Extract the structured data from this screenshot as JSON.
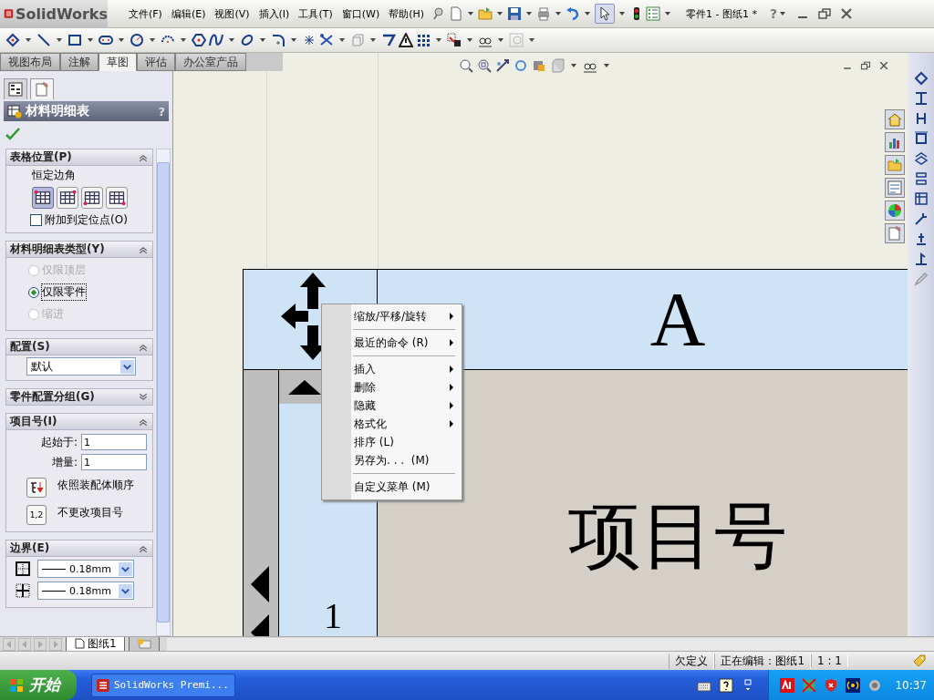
{
  "app": {
    "logo": "SolidWorks",
    "document_title": "零件1 - 图纸1 *",
    "help": "?"
  },
  "menu": [
    "文件(F)",
    "编辑(E)",
    "视图(V)",
    "插入(I)",
    "工具(T)",
    "窗口(W)",
    "帮助(H)"
  ],
  "command_tabs": [
    {
      "label": "视图布局",
      "selected": false
    },
    {
      "label": "注解",
      "selected": false
    },
    {
      "label": "草图",
      "selected": true
    },
    {
      "label": "评估",
      "selected": false
    },
    {
      "label": "办公室产品",
      "selected": false
    }
  ],
  "panel": {
    "tabs": [
      {
        "kind": "tree",
        "selected": false
      },
      {
        "kind": "property",
        "selected": true
      }
    ],
    "title": "材料明细表",
    "help": "?",
    "table_position": {
      "title": "表格位置(P)",
      "expanded": true,
      "caption": "恒定边角",
      "anchors": [
        {
          "selected": true
        },
        {
          "selected": false
        },
        {
          "selected": false
        },
        {
          "selected": false
        }
      ],
      "attach": {
        "label": "附加到定位点(O)",
        "checked": false
      }
    },
    "bom_type": {
      "title": "材料明细表类型(Y)",
      "expanded": true,
      "options": [
        {
          "label": "仅限顶层",
          "selected": false,
          "disabled": true
        },
        {
          "label": "仅限零件",
          "selected": true,
          "disabled": false
        },
        {
          "label": "缩进",
          "selected": false,
          "disabled": true
        }
      ]
    },
    "configuration": {
      "title": "配置(S)",
      "expanded": true,
      "value": "默认"
    },
    "part_grouping": {
      "title": "零件配置分组(G)",
      "expanded": false
    },
    "item_numbers": {
      "title": "项目号(I)",
      "expanded": true,
      "fields": [
        {
          "label": "起始于:",
          "value": "1"
        },
        {
          "label": "增量:",
          "value": "1"
        }
      ],
      "options": [
        {
          "kind": "assembly-order",
          "label": "依照装配体顺序"
        },
        {
          "kind": "keep",
          "button_text": "1,2",
          "label": "不更改项目号"
        }
      ]
    },
    "border": {
      "title": "边界(E)",
      "expanded": true,
      "lines": [
        {
          "kind": "outer",
          "value": "0.18mm"
        },
        {
          "kind": "inner",
          "value": "0.18mm"
        }
      ]
    }
  },
  "drawing": {
    "column_header": "A",
    "header_cell": "项目号",
    "row_number": "1"
  },
  "context_menu": [
    [
      {
        "label": "缩放/平移/旋转",
        "submenu": true
      }
    ],
    [
      {
        "label": "最近的命令 (R)",
        "submenu": true
      }
    ],
    [
      {
        "label": "插入",
        "submenu": true
      },
      {
        "label": "删除",
        "submenu": true
      },
      {
        "label": "隐藏",
        "submenu": true
      },
      {
        "label": "格式化",
        "submenu": true
      },
      {
        "label": "排序 (L)",
        "submenu": false
      },
      {
        "label": "另存为. . .  (M)",
        "submenu": false
      }
    ],
    [
      {
        "label": "自定义菜单 (M)",
        "submenu": false
      }
    ]
  ],
  "sheet_tabs": [
    {
      "label": "图纸1",
      "selected": true
    }
  ],
  "status_bar": [
    "欠定义",
    "正在编辑：图纸1",
    "1 : 1"
  ],
  "taskbar": {
    "start": "开始",
    "windows": [
      {
        "label": "SolidWorks Premi..."
      }
    ],
    "clock": "10:37"
  }
}
